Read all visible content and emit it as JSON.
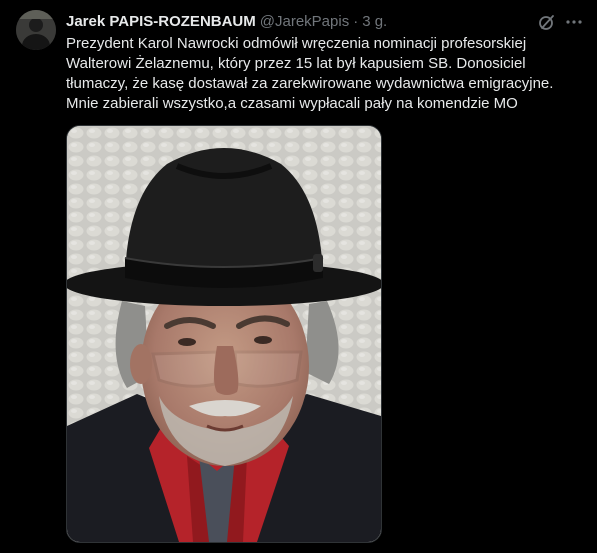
{
  "tweet": {
    "author_name": "Jarek PAPIS-ROZENBAUM",
    "author_handle": "@JarekPapis",
    "separator": "·",
    "time_ago": "3 g.",
    "text_lines": [
      "Prezydent Karol Nawrocki odmówił wręczenia nominacji profesorskiej",
      "Walterowi Żelaznemu, który przez 15 lat był kapusiem SB. Donosiciel",
      "tłumaczy, że kasę dostawał za zarekwirowane wydawnictwa emigracyjne.",
      "Mnie zabierali wszystko,a czasami wypłacali pały na komendzie MO"
    ]
  },
  "icons": {
    "grok": "grok-icon",
    "more": "more-options-icon"
  },
  "colors": {
    "background": "#000000",
    "text_primary": "#e7e9ea",
    "text_secondary": "#71767b",
    "border": "#2f3336"
  }
}
